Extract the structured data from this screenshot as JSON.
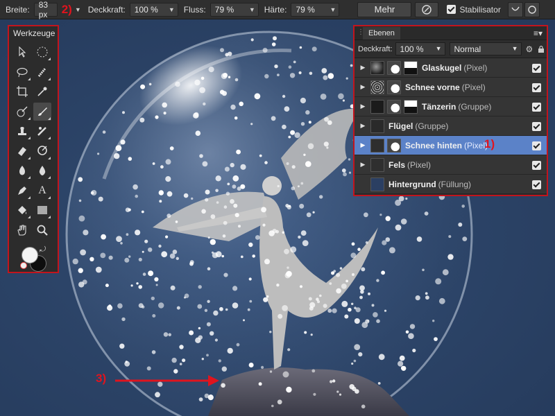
{
  "toolbar": {
    "width_label": "Breite:",
    "width_value": "83 px",
    "annotation_2": "2)",
    "opacity_label": "Deckkraft:",
    "opacity_value": "100 %",
    "flow_label": "Fluss:",
    "flow_value": "79 %",
    "hardness_label": "Härte:",
    "hardness_value": "79 %",
    "more_label": "Mehr",
    "stabilizer_label": "Stabilisator"
  },
  "tools": {
    "title": "Werkzeuge",
    "text_tool_glyph": "A"
  },
  "layers": {
    "tab_label": "Ebenen",
    "opacity_label": "Deckkraft:",
    "opacity_value": "100 %",
    "blend_mode": "Normal",
    "annotation_1": "1)",
    "items": [
      {
        "name": "Glaskugel",
        "type": "(Pixel)",
        "selected": false
      },
      {
        "name": "Schnee vorne",
        "type": "(Pixel)",
        "selected": false
      },
      {
        "name": "Tänzerin",
        "type": "(Gruppe)",
        "selected": false
      },
      {
        "name": "Flügel",
        "type": "(Gruppe)",
        "selected": false
      },
      {
        "name": "Schnee hinten",
        "type": "(Pixel)",
        "selected": true
      },
      {
        "name": "Fels",
        "type": "(Pixel)",
        "selected": false
      },
      {
        "name": "Hintergrund",
        "type": "(Füllung)",
        "selected": false
      }
    ]
  },
  "canvas": {
    "annotation_3": "3)"
  },
  "colors": {
    "annotation_red": "#e0141e",
    "selection_blue": "#5b82c8",
    "background_navy": "#2b3f62"
  }
}
